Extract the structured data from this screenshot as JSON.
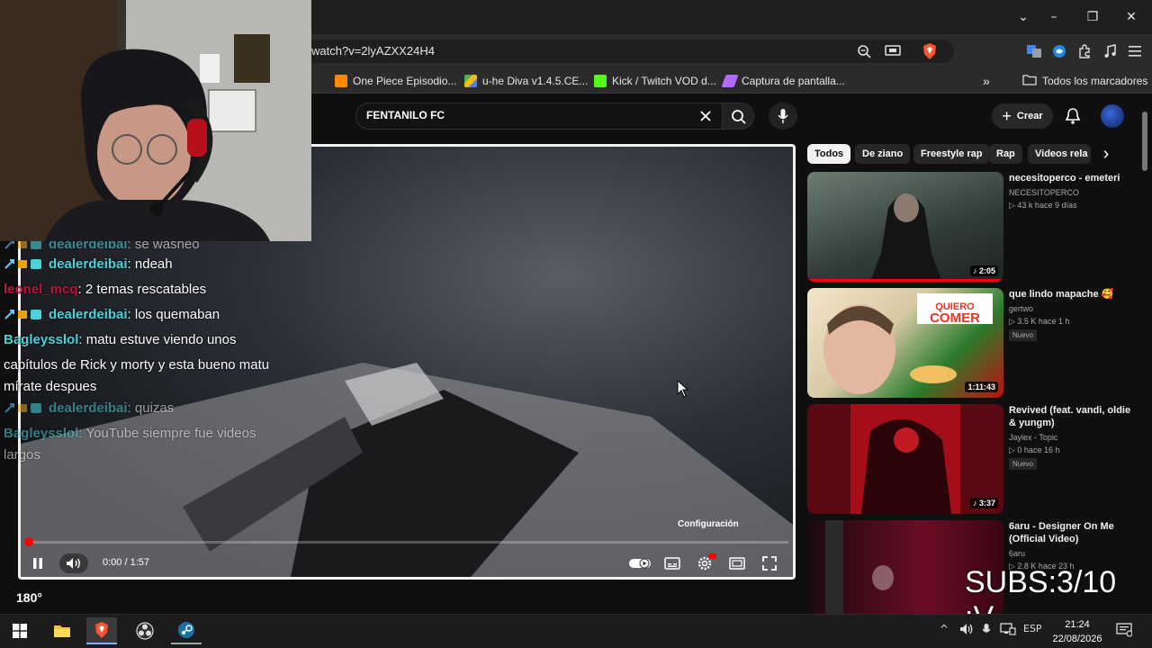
{
  "browser": {
    "url": "watch?v=2lyAZXX24H4",
    "window_controls": {
      "menu": "⌄",
      "minimize": "–",
      "restore": "❐",
      "close": "✕"
    }
  },
  "bookmarks": {
    "items": [
      {
        "label": "One Piece Episodio...",
        "color": "#ff8a00"
      },
      {
        "label": "u-he Diva v1.4.5.CE...",
        "color": "#4caf50"
      },
      {
        "label": "Kick / Twitch VOD d...",
        "color": "#53fc18"
      },
      {
        "label": "Captura de pantalla...",
        "color": "#b36bff"
      }
    ],
    "overflow": "»",
    "all_bookmarks": "Todos los marcadores"
  },
  "youtube": {
    "search_value": "FENTANILO FC",
    "create_label": "Crear",
    "chips": [
      "Todos",
      "De ziano",
      "Freestyle rap",
      "Rap",
      "Videos rela"
    ],
    "chips_next": "›"
  },
  "player": {
    "time": "0:00 / 1:57",
    "progress": 0.003,
    "settings_tooltip": "Configuración"
  },
  "chat": [
    {
      "user": "dealerdeibai",
      "text": ": se washeó",
      "color": "#4fd1d9",
      "badges": true
    },
    {
      "user": "dealerdeibai",
      "text": ": ndeah",
      "color": "#4fd1d9",
      "badges": true
    },
    {
      "user": "leonel_mcq",
      "text": ": 2 temas rescatables",
      "color": "#c0143c",
      "badges": false
    },
    {
      "user": "dealerdeibai",
      "text": ": los quemaban",
      "color": "#4fd1d9",
      "badges": true
    },
    {
      "user": "Bagleysslol",
      "text": ": matu estuve viendo unos",
      "color": "#4fd1d9",
      "badges": false
    },
    {
      "user": "",
      "text": "capítulos de Rick y morty y esta bueno matu",
      "color": "#ffffff",
      "badges": false
    },
    {
      "user": "",
      "text": "mírate despues",
      "color": "#ffffff",
      "badges": false
    },
    {
      "user": "dealerdeibai",
      "text": ": quizas",
      "color": "#4fd1d9",
      "badges": true
    },
    {
      "user": "Bagleysslol",
      "text": ": YouTube siempre fue videos",
      "color": "#4fd1d9",
      "badges": false
    },
    {
      "user": "",
      "text": "largos",
      "color": "#ffffff",
      "badges": false
    }
  ],
  "recommendations": [
    {
      "title": "necesitoperco - emeteri",
      "channel": "NECESITOPERCO",
      "stats": "▷ 43 k  hace 9 días",
      "duration": "♪ 2:05",
      "badge": "",
      "bg": "#3a4a44"
    },
    {
      "title": "que lindo mapache 🥰",
      "channel": "gertwo",
      "stats": "▷ 3.5 K  hace 1 h",
      "duration": "1:11:43",
      "badge": "Nuevo",
      "bg": "#d64a2a"
    },
    {
      "title": "Revived (feat. vandi, oldie & yungm)",
      "channel": "Jaylex - Topic",
      "stats": "▷ 0  hace 16 h",
      "duration": "♪ 3:37",
      "badge": "Nuevo",
      "bg": "#8a0b14"
    },
    {
      "title": "6aru - Designer On Me (Official Video)",
      "channel": "6aru",
      "stats": "▷ 2.8 K  hace 23 h",
      "duration": "",
      "badge": "",
      "bg": "#5a0a1e"
    }
  ],
  "overlay": {
    "subs": "SUBS:3/10 :V",
    "temperature": "180°"
  },
  "taskbar": {
    "lang": "ESP",
    "time": "21:24",
    "date": "22/08/2026"
  }
}
